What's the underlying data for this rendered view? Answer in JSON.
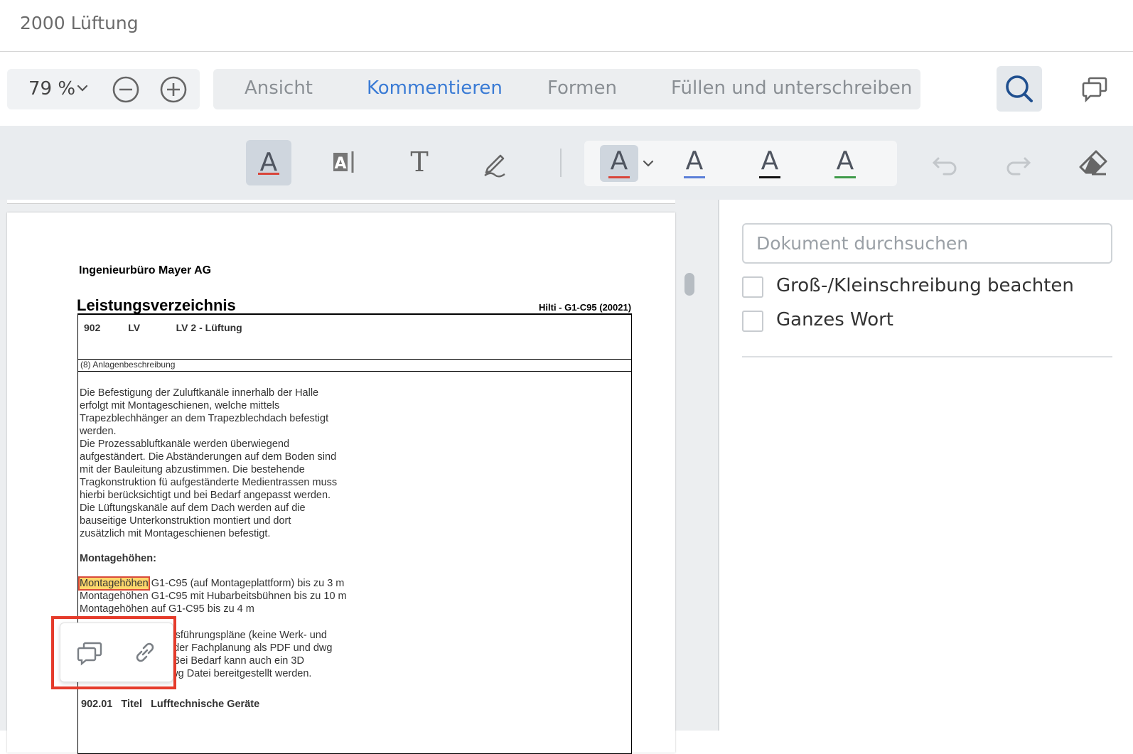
{
  "window": {
    "title": "2000 Lüftung"
  },
  "zoom": {
    "value": "79 %"
  },
  "tabs": [
    {
      "label": "Ansicht"
    },
    {
      "label": "Kommentieren"
    },
    {
      "label": "Formen"
    },
    {
      "label": "Füllen und unterschreiben"
    }
  ],
  "active_tab": "Kommentieren",
  "colors": {
    "accent": "#3a7bd5",
    "underline_red": "#d9453a",
    "underline_blue": "#5b7fd8",
    "underline_black": "#111111",
    "underline_green": "#3f9a4a",
    "highlight": "#fcd76b",
    "frame_red": "#e53b2b"
  },
  "document": {
    "company": "Ingenieurbüro Mayer AG",
    "heading": "Leistungsverzeichnis",
    "ref": "Hilti - G1-C95 (20021)",
    "header_row": "902          LV             LV 2 - Lüftung",
    "section_label": "(8) Anlagenbeschreibung",
    "body_lines": [
      "Die Befestigung der Zuluftkanäle innerhalb der Halle",
      "erfolgt mit Montageschienen, welche mittels",
      "Trapezblechhänger an dem Trapezblechdach befestigt",
      "werden.",
      "Die Prozessabluftkanäle werden überwiegend",
      "aufgeständert. Die Abständerungen auf dem Boden sind",
      "mit der Bauleitung abzustimmen. Die bestehende",
      "Tragkonstruktion fü aufgeständerte Medientrassen muss",
      "hierbi berücksichtigt und bei Bedarf angepasst werden.",
      "Die Lüftungskanäle auf dem Dach werden auf die",
      "bauseitige Unterkonstruktion montiert und dort",
      "zusätzlich mit Montageschienen befestigt."
    ],
    "montage_heading": "Montagehöhen:",
    "montage_highlight": "Montagehöhen",
    "montage_line1_rest": " G1-C95 (auf Montageplattform) bis zu 3 m",
    "montage_line2": "Montagehöhen G1-C95 mit Hubarbeitsbühnen bis zu 10 m",
    "montage_line3": "Montagehöhen auf G1-C95 bis zu 4 m",
    "more_lines": [
      "                           r Ausführungspläne (keine Werk- und",
      "                          ens der Fachplanung als PDF und dwg",
      "                          ellt. Bei Bedarf kann auch ein 3D",
      "Modell als nwd/3d dwg Datei bereitgestellt werden."
    ],
    "titel_line": "902.01   Titel   Lufftechnische Geräte"
  },
  "search_panel": {
    "placeholder": "Dokument durchsuchen",
    "value": "",
    "options": [
      {
        "label": "Groß-/Kleinschreibung beachten",
        "checked": false
      },
      {
        "label": "Ganzes Wort",
        "checked": false
      }
    ]
  },
  "popup": {
    "icons": [
      "comment-icon",
      "link-icon"
    ]
  }
}
